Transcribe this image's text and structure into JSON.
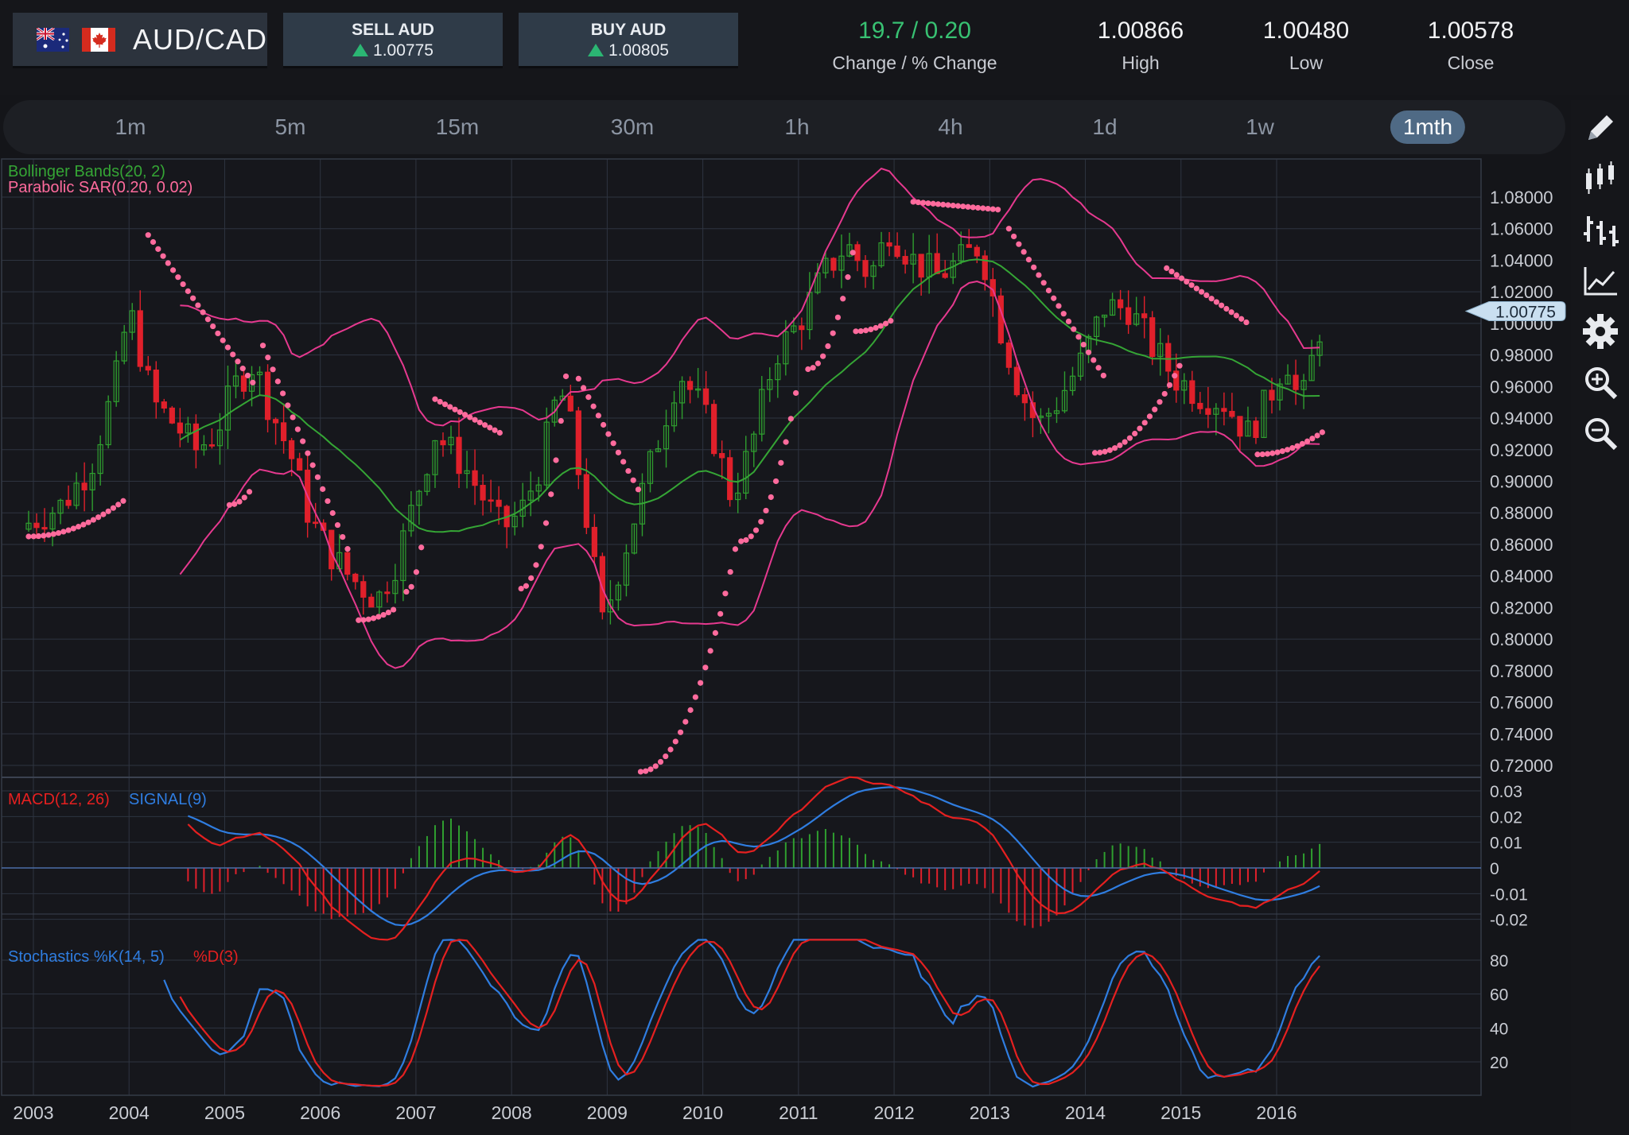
{
  "header": {
    "pair": "AUD/CAD",
    "sell": {
      "label": "SELL AUD",
      "price": "1.00775"
    },
    "buy": {
      "label": "BUY AUD",
      "price": "1.00805"
    },
    "change": {
      "value": "19.7 / 0.20",
      "label": "Change / % Change"
    },
    "high": {
      "value": "1.00866",
      "label": "High"
    },
    "low": {
      "value": "1.00480",
      "label": "Low"
    },
    "close": {
      "value": "1.00578",
      "label": "Close"
    }
  },
  "timeframes": [
    "1m",
    "5m",
    "15m",
    "30m",
    "1h",
    "4h",
    "1d",
    "1w",
    "1mth"
  ],
  "active_timeframe": "1mth",
  "toolbar": [
    "pencil-icon",
    "candlestick-icon",
    "bar-chart-icon",
    "line-chart-icon",
    "gear-icon",
    "zoom-in-icon",
    "zoom-out-icon"
  ],
  "colors": {
    "up": "#2f9e2f",
    "down": "#e0202b",
    "bollinger_band": "#e6398f",
    "bollinger_mid": "#35a535",
    "sar": "#ff6b9d",
    "macd": "#e52020",
    "signal": "#2f7de0",
    "stoch_k": "#2f7de0",
    "stoch_d": "#e52020",
    "accent": "#4f6a85"
  },
  "chart_data": {
    "type": "candlestick",
    "instrument": "AUD/CAD",
    "interval": "1mth",
    "current_price": "1.00775",
    "x_ticks": [
      "2003",
      "2004",
      "2005",
      "2006",
      "2007",
      "2008",
      "2009",
      "2010",
      "2011",
      "2012",
      "2013",
      "2014",
      "2015",
      "2016"
    ],
    "price_ticks": [
      "1.08000",
      "1.06000",
      "1.04000",
      "1.02000",
      "1.00000",
      "0.98000",
      "0.96000",
      "0.94000",
      "0.92000",
      "0.90000",
      "0.88000",
      "0.86000",
      "0.84000",
      "0.82000",
      "0.80000",
      "0.78000",
      "0.76000",
      "0.74000",
      "0.72000"
    ],
    "macd_ticks": [
      "0.03",
      "0.02",
      "0.01",
      "0",
      "-0.01",
      "-0.02"
    ],
    "stoch_ticks": [
      "80",
      "60",
      "40",
      "20"
    ],
    "legends": {
      "bollinger": "Bollinger Bands(20, 2)",
      "sar": "Parabolic SAR(0.20, 0.02)",
      "macd": "MACD(12, 26)",
      "signal": "SIGNAL(9)",
      "stoch_k": "Stochastics %K(14, 5)",
      "stoch_d": "%D(3)"
    },
    "close_path": [
      [
        2002.9,
        0.872
      ],
      [
        2003.3,
        0.885
      ],
      [
        2003.6,
        0.91
      ],
      [
        2003.85,
        0.96
      ],
      [
        2004.0,
        1.01
      ],
      [
        2004.25,
        0.95
      ],
      [
        2004.5,
        0.935
      ],
      [
        2004.7,
        0.92
      ],
      [
        2004.9,
        0.93
      ],
      [
        2005.1,
        0.96
      ],
      [
        2005.3,
        0.975
      ],
      [
        2005.45,
        0.95
      ],
      [
        2005.7,
        0.915
      ],
      [
        2005.9,
        0.875
      ],
      [
        2006.1,
        0.855
      ],
      [
        2006.3,
        0.84
      ],
      [
        2006.6,
        0.825
      ],
      [
        2006.8,
        0.85
      ],
      [
        2007.0,
        0.89
      ],
      [
        2007.2,
        0.93
      ],
      [
        2007.5,
        0.91
      ],
      [
        2007.7,
        0.89
      ],
      [
        2007.9,
        0.87
      ],
      [
        2008.1,
        0.88
      ],
      [
        2008.3,
        0.91
      ],
      [
        2008.5,
        0.96
      ],
      [
        2008.6,
        0.94
      ],
      [
        2008.75,
        0.89
      ],
      [
        2008.95,
        0.81
      ],
      [
        2009.1,
        0.84
      ],
      [
        2009.3,
        0.88
      ],
      [
        2009.5,
        0.92
      ],
      [
        2009.75,
        0.97
      ],
      [
        2009.95,
        0.95
      ],
      [
        2010.1,
        0.93
      ],
      [
        2010.3,
        0.89
      ],
      [
        2010.5,
        0.92
      ],
      [
        2010.75,
        0.98
      ],
      [
        2011.0,
        1.0
      ],
      [
        2011.25,
        1.03
      ],
      [
        2011.5,
        1.05
      ],
      [
        2011.75,
        1.03
      ],
      [
        2011.95,
        1.06
      ],
      [
        2012.2,
        1.04
      ],
      [
        2012.45,
        1.03
      ],
      [
        2012.7,
        1.04
      ],
      [
        2012.9,
        1.05
      ],
      [
        2013.1,
        1.0
      ],
      [
        2013.3,
        0.96
      ],
      [
        2013.5,
        0.935
      ],
      [
        2013.7,
        0.95
      ],
      [
        2013.95,
        0.975
      ],
      [
        2014.2,
        1.01
      ],
      [
        2014.45,
        1.01
      ],
      [
        2014.7,
        0.985
      ],
      [
        2014.95,
        0.965
      ],
      [
        2015.2,
        0.955
      ],
      [
        2015.45,
        0.95
      ],
      [
        2015.7,
        0.93
      ],
      [
        2015.9,
        0.95
      ],
      [
        2016.1,
        0.98
      ],
      [
        2016.25,
        0.945
      ],
      [
        2016.4,
        0.985
      ],
      [
        2016.5,
        1.0078
      ]
    ],
    "sar_segments": [
      {
        "from": [
          2002.95,
          0.865
        ],
        "to": [
          2003.95,
          0.888
        ],
        "side": "below"
      },
      {
        "from": [
          2004.2,
          1.056
        ],
        "to": [
          2005.3,
          0.962
        ],
        "side": "above"
      },
      {
        "from": [
          2005.05,
          0.885
        ],
        "to": [
          2005.3,
          0.897
        ],
        "side": "below"
      },
      {
        "from": [
          2005.4,
          0.986
        ],
        "to": [
          2006.3,
          0.855
        ],
        "side": "above"
      },
      {
        "from": [
          2006.4,
          0.812
        ],
        "to": [
          2006.8,
          0.82
        ],
        "side": "below"
      },
      {
        "from": [
          2006.9,
          0.83
        ],
        "to": [
          2007.1,
          0.876
        ],
        "side": "below"
      },
      {
        "from": [
          2007.2,
          0.952
        ],
        "to": [
          2007.9,
          0.93
        ],
        "side": "above"
      },
      {
        "from": [
          2008.1,
          0.832
        ],
        "to": [
          2008.6,
          0.985
        ],
        "side": "below"
      },
      {
        "from": [
          2008.7,
          0.965
        ],
        "to": [
          2009.35,
          0.892
        ],
        "side": "above"
      },
      {
        "from": [
          2009.35,
          0.716
        ],
        "to": [
          2010.35,
          0.86
        ],
        "side": "below"
      },
      {
        "from": [
          2010.4,
          0.862
        ],
        "to": [
          2011.0,
          0.965
        ],
        "side": "below"
      },
      {
        "from": [
          2011.1,
          0.971
        ],
        "to": [
          2011.6,
          1.055
        ],
        "side": "below"
      },
      {
        "from": [
          2011.6,
          0.995
        ],
        "to": [
          2012.0,
          1.003
        ],
        "side": "below"
      },
      {
        "from": [
          2012.2,
          1.077
        ],
        "to": [
          2013.1,
          1.072
        ],
        "side": "above"
      },
      {
        "from": [
          2013.2,
          1.06
        ],
        "to": [
          2014.2,
          0.966
        ],
        "side": "above"
      },
      {
        "from": [
          2014.1,
          0.918
        ],
        "to": [
          2015.0,
          0.975
        ],
        "side": "below"
      },
      {
        "from": [
          2014.85,
          1.035
        ],
        "to": [
          2015.7,
          1.0
        ],
        "side": "above"
      },
      {
        "from": [
          2015.8,
          0.917
        ],
        "to": [
          2016.5,
          0.932
        ],
        "side": "below"
      }
    ]
  }
}
